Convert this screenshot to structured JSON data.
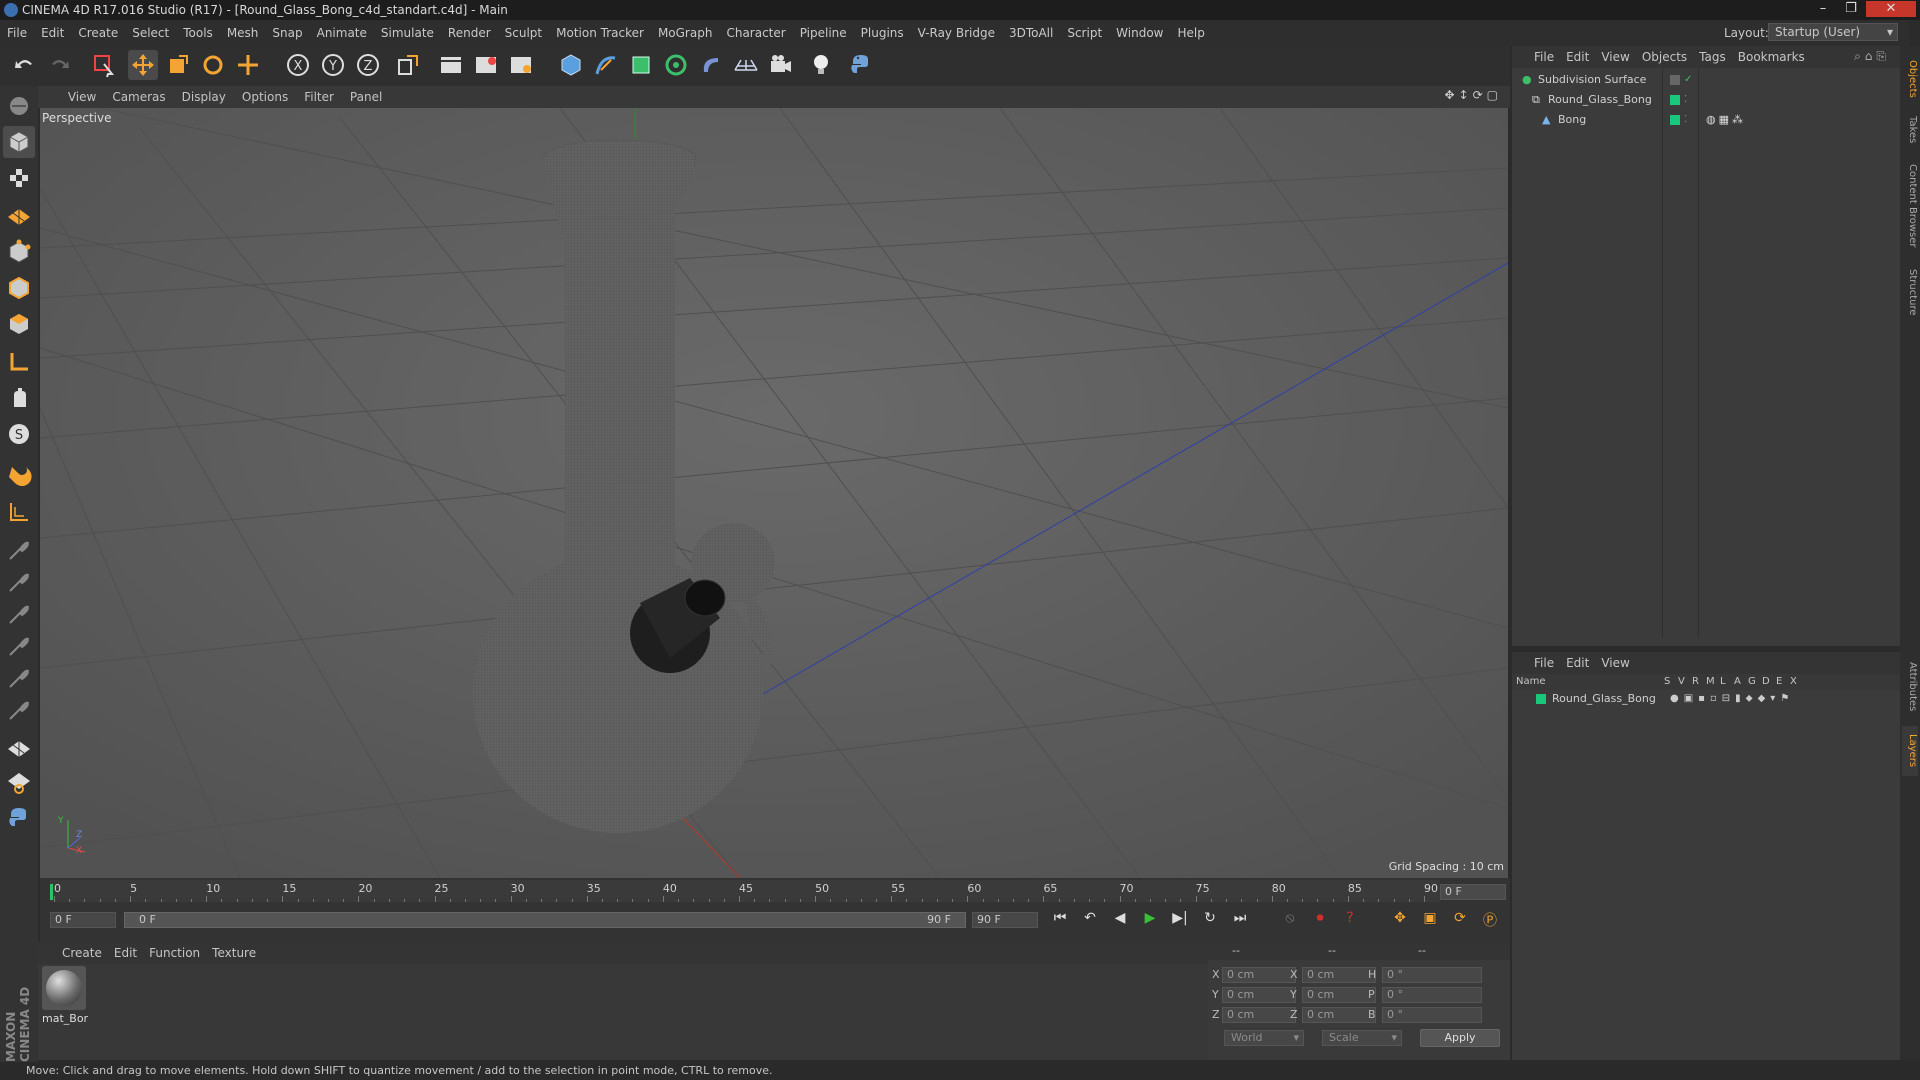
{
  "window": {
    "title": "CINEMA 4D R17.016 Studio (R17) - [Round_Glass_Bong_c4d_standart.c4d] - Main"
  },
  "menubar": [
    "File",
    "Edit",
    "Create",
    "Select",
    "Tools",
    "Mesh",
    "Snap",
    "Animate",
    "Simulate",
    "Render",
    "Sculpt",
    "Motion Tracker",
    "MoGraph",
    "Character",
    "Pipeline",
    "Plugins",
    "V-Ray Bridge",
    "3DToAll",
    "Script",
    "Window",
    "Help"
  ],
  "layout": {
    "label": "Layout:",
    "value": "Startup (User)"
  },
  "viewport": {
    "menu": [
      "View",
      "Cameras",
      "Display",
      "Options",
      "Filter",
      "Panel"
    ],
    "camera_label": "Perspective",
    "grid_spacing": "Grid Spacing : 10 cm",
    "axis_labels": {
      "y": "Y",
      "z": "Z",
      "x": "X"
    }
  },
  "timeline": {
    "ticks": [
      "0",
      "5",
      "10",
      "15",
      "20",
      "25",
      "30",
      "35",
      "40",
      "45",
      "50",
      "55",
      "60",
      "65",
      "70",
      "75",
      "80",
      "85",
      "90"
    ],
    "current_frame_right": "0 F",
    "start_field": "0 F",
    "range_start": "0 F",
    "range_end": "90 F",
    "end_field": "90 F"
  },
  "materials": {
    "menu": [
      "Create",
      "Edit",
      "Function",
      "Texture"
    ],
    "items": [
      {
        "name": "mat_Bor"
      }
    ]
  },
  "coordinates": {
    "header": [
      "--",
      "--",
      "--"
    ],
    "rows": [
      {
        "l1": "X",
        "v1": "0 cm",
        "l2": "X",
        "v2": "0 cm",
        "l3": "H",
        "v3": "0 °"
      },
      {
        "l1": "Y",
        "v1": "0 cm",
        "l2": "Y",
        "v2": "0 cm",
        "l3": "P",
        "v3": "0 °"
      },
      {
        "l1": "Z",
        "v1": "0 cm",
        "l2": "Z",
        "v2": "0 cm",
        "l3": "B",
        "v3": "0 °"
      }
    ],
    "world": "World",
    "scale": "Scale",
    "apply": "Apply"
  },
  "objects_panel": {
    "menu": [
      "File",
      "Edit",
      "View",
      "Objects",
      "Tags",
      "Bookmarks"
    ],
    "items": [
      {
        "name": "Subdivision Surface",
        "level": 0
      },
      {
        "name": "Round_Glass_Bong",
        "level": 1
      },
      {
        "name": "Bong",
        "level": 2
      }
    ]
  },
  "layers_panel": {
    "menu": [
      "File",
      "Edit",
      "View"
    ],
    "columns": [
      "Name",
      "S",
      "V",
      "R",
      "M",
      "L",
      "A",
      "G",
      "D",
      "E",
      "X"
    ],
    "items": [
      {
        "name": "Round_Glass_Bong"
      }
    ]
  },
  "side_tabs": [
    "Objects",
    "Takes",
    "Content Browser",
    "Structure",
    "Attributes",
    "Layers"
  ],
  "status": "Move: Click and drag to move elements. Hold down SHIFT to quantize movement / add to the selection in point mode, CTRL to remove.",
  "brand": {
    "line1": "MAXON",
    "line2": "CINEMA 4D"
  },
  "colors": {
    "layer_green": "#19c87a",
    "accent_orange": "#f3a433",
    "play_green": "#3bbf3b",
    "record_red": "#d0302a"
  }
}
